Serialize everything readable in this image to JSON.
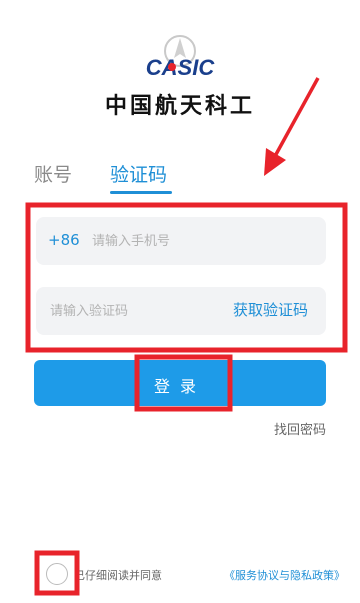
{
  "header": {
    "logo_text": "CASIC",
    "brand_name": "中国航天科工"
  },
  "tabs": [
    {
      "label": "账号",
      "active": false
    },
    {
      "label": "验证码",
      "active": true
    }
  ],
  "phone": {
    "prefix": "+86",
    "placeholder": "请输入手机号",
    "value": ""
  },
  "code": {
    "placeholder": "请输入验证码",
    "value": "",
    "get_code_label": "获取验证码"
  },
  "login_label": "登录",
  "forgot_label": "找回密码",
  "agreement": {
    "text": "已仔细阅读并同意",
    "link": "《服务协议与隐私政策》",
    "checked": false
  },
  "colors": {
    "accent": "#1e9be8",
    "annotation": "#e8232b"
  }
}
